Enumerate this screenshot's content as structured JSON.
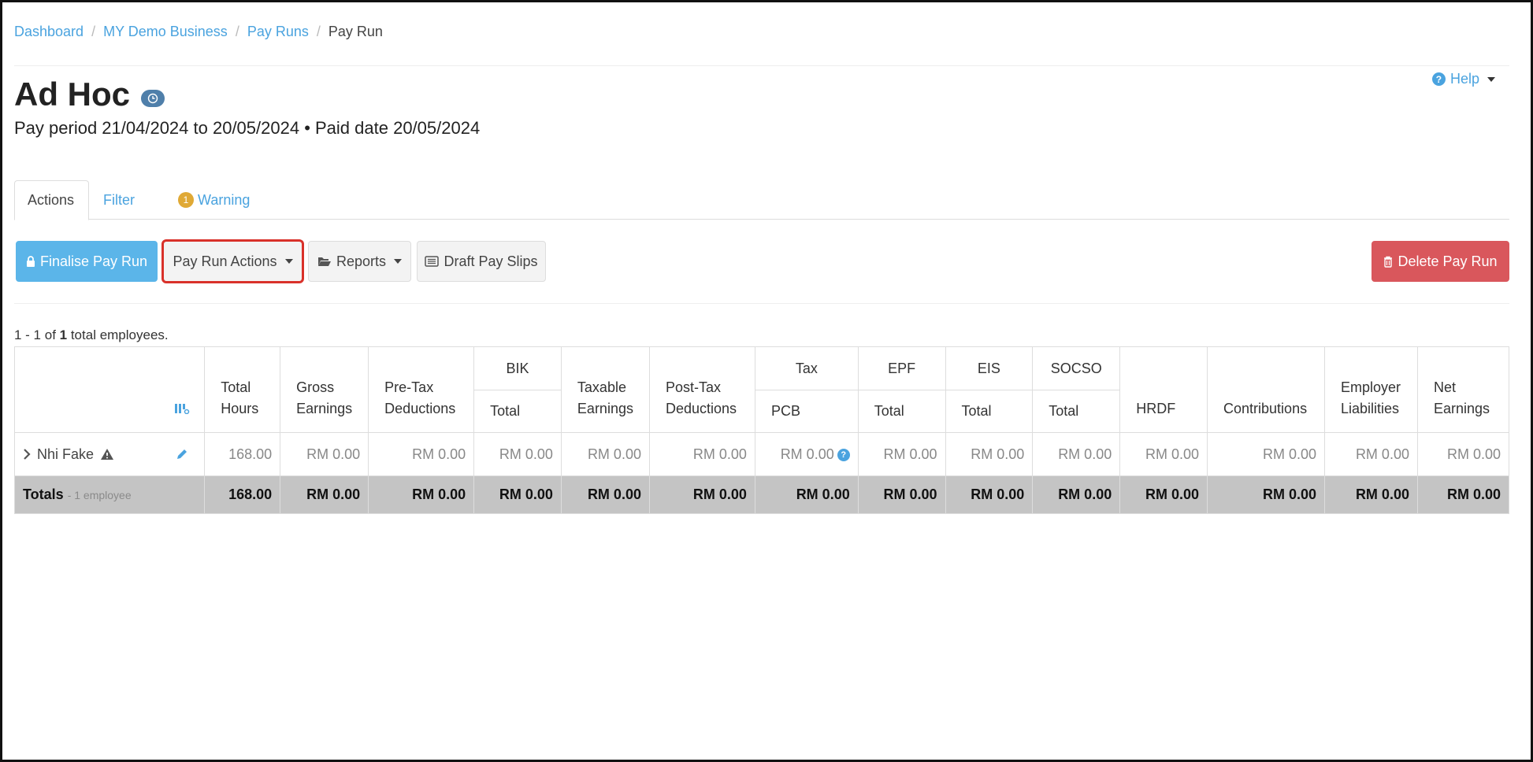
{
  "breadcrumb": {
    "items": [
      "Dashboard",
      "MY Demo Business",
      "Pay Runs"
    ],
    "current": "Pay Run",
    "separator": "/"
  },
  "header": {
    "title": "Ad Hoc",
    "subtitle": "Pay period 21/04/2024 to 20/05/2024 • Paid date 20/05/2024",
    "help_label": "Help"
  },
  "tabs": {
    "actions": "Actions",
    "filter": "Filter",
    "warning": "Warning",
    "warning_count": "1"
  },
  "toolbar": {
    "finalise": "Finalise Pay Run",
    "pay_run_actions": "Pay Run Actions",
    "reports": "Reports",
    "draft_pay_slips": "Draft Pay Slips",
    "delete": "Delete Pay Run"
  },
  "summary": {
    "prefix": "1 - 1 of ",
    "total": "1",
    "suffix": " total employees."
  },
  "table": {
    "headers": {
      "total_hours": [
        "Total",
        "Hours"
      ],
      "gross_earnings": [
        "Gross",
        "Earnings"
      ],
      "pre_tax": [
        "Pre-Tax",
        "Deductions"
      ],
      "bik": "BIK",
      "bik_total": "Total",
      "taxable": [
        "Taxable",
        "Earnings"
      ],
      "post_tax": [
        "Post-Tax",
        "Deductions"
      ],
      "tax": "Tax",
      "tax_pcb": "PCB",
      "epf": "EPF",
      "epf_total": "Total",
      "eis": "EIS",
      "eis_total": "Total",
      "socso": "SOCSO",
      "socso_total": "Total",
      "hrdf": "HRDF",
      "contributions": "Contributions",
      "employer_liabilities": [
        "Employer",
        "Liabilities"
      ],
      "net_earnings": [
        "Net",
        "Earnings"
      ]
    },
    "employee": {
      "name": "Nhi Fake",
      "total_hours": "168.00",
      "gross": "RM 0.00",
      "pre_tax": "RM 0.00",
      "bik": "RM 0.00",
      "taxable": "RM 0.00",
      "post_tax": "RM 0.00",
      "pcb": "RM 0.00",
      "epf": "RM 0.00",
      "eis": "RM 0.00",
      "socso": "RM 0.00",
      "hrdf": "RM 0.00",
      "contributions": "RM 0.00",
      "employer_liabilities": "RM 0.00",
      "net": "RM 0.00"
    },
    "totals": {
      "label": "Totals",
      "sublabel": "- 1 employee",
      "total_hours": "168.00",
      "gross": "RM 0.00",
      "pre_tax": "RM 0.00",
      "bik": "RM 0.00",
      "taxable": "RM 0.00",
      "post_tax": "RM 0.00",
      "pcb": "RM 0.00",
      "epf": "RM 0.00",
      "eis": "RM 0.00",
      "socso": "RM 0.00",
      "hrdf": "RM 0.00",
      "contributions": "RM 0.00",
      "employer_liabilities": "RM 0.00",
      "net": "RM 0.00"
    }
  },
  "colors": {
    "link": "#4aa3df",
    "finalise": "#5bb5e9",
    "delete": "#d9575c",
    "warning": "#e0a935",
    "highlight": "#d9312a"
  },
  "icons": {
    "finalise": "lock-icon",
    "reports": "folder-open-icon",
    "draft": "list-icon",
    "delete": "trash-icon",
    "help": "question-circle-icon",
    "status": "clock-icon",
    "expand": "chevron-right-icon",
    "warning": "warning-triangle-icon",
    "edit": "pencil-icon",
    "columns": "columns-settings-icon"
  }
}
